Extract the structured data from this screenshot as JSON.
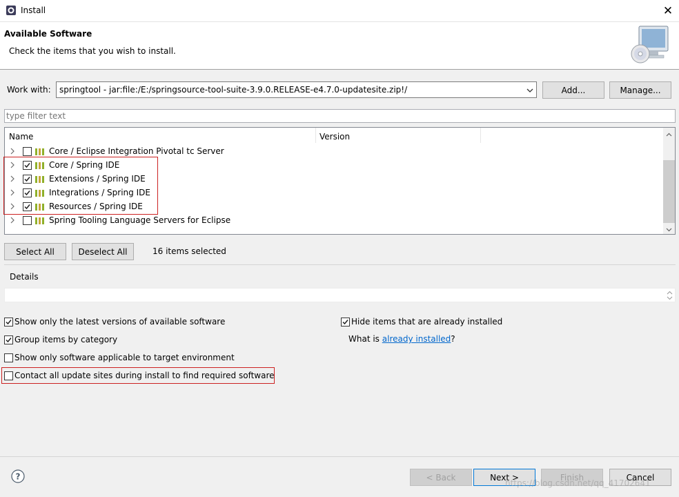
{
  "window": {
    "title": "Install",
    "close_glyph": "✕"
  },
  "banner": {
    "title": "Available Software",
    "description": "Check the items that you wish to install.",
    "image_icon": "install-cd-monitor-icon"
  },
  "work_with": {
    "label": "Work with:",
    "value": "springtool - jar:file:/E:/springsource-tool-suite-3.9.0.RELEASE-e4.7.0-updatesite.zip!/",
    "add_label": "Add...",
    "manage_label": "Manage..."
  },
  "filter": {
    "placeholder": "type filter text"
  },
  "tree": {
    "columns": [
      "Name",
      "Version"
    ],
    "rows": [
      {
        "label": "Core / Eclipse Integration Pivotal tc Server",
        "checked": false
      },
      {
        "label": "Core / Spring IDE",
        "checked": true
      },
      {
        "label": "Extensions / Spring IDE",
        "checked": true
      },
      {
        "label": "Integrations / Spring IDE",
        "checked": true
      },
      {
        "label": "Resources / Spring IDE",
        "checked": true
      },
      {
        "label": "Spring Tooling Language Servers for Eclipse",
        "checked": false
      }
    ]
  },
  "selection": {
    "select_all_label": "Select All",
    "deselect_all_label": "Deselect All",
    "count_text": "16 items selected"
  },
  "details": {
    "label": "Details"
  },
  "options": {
    "latest_versions": {
      "label": "Show only the latest versions of available software",
      "checked": true
    },
    "group_by_category": {
      "label": "Group items by category",
      "checked": true
    },
    "target_env": {
      "label": "Show only software applicable to target environment",
      "checked": false
    },
    "contact_sites": {
      "label": "Contact all update sites during install to find required software",
      "checked": false
    },
    "hide_installed": {
      "label": "Hide items that are already installed",
      "checked": true
    },
    "what_is_prefix": "What is ",
    "what_is_link": "already installed",
    "what_is_suffix": "?"
  },
  "footer": {
    "back_label": "< Back",
    "next_label": "Next >",
    "finish_label": "Finish",
    "cancel_label": "Cancel",
    "watermark": "https://blog.csdn.net/qq_41702641"
  },
  "colors": {
    "highlight_box": "#cc2020",
    "link": "#0066cc",
    "default_button_border": "#0078d7"
  }
}
